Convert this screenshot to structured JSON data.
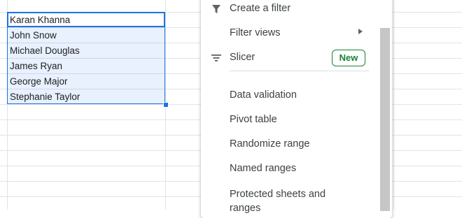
{
  "sheet": {
    "selected_cells": [
      "Karan Khanna",
      "John Snow",
      "Michael Douglas",
      "James Ryan",
      "George Major",
      "Stephanie Taylor"
    ]
  },
  "menu": {
    "items": [
      {
        "label": "Create a filter",
        "icon": "filter-icon"
      },
      {
        "label": "Filter views",
        "icon": "",
        "submenu": true
      },
      {
        "label": "Slicer",
        "icon": "slicer-icon",
        "badge": "New"
      },
      {
        "label": "Data validation"
      },
      {
        "label": "Pivot table"
      },
      {
        "label": "Randomize range"
      },
      {
        "label": "Named ranges"
      },
      {
        "label": "Protected sheets and ranges"
      }
    ]
  },
  "colors": {
    "selection_border": "#1a73e8",
    "badge_green": "#188038",
    "menu_text": "#3c4043"
  }
}
